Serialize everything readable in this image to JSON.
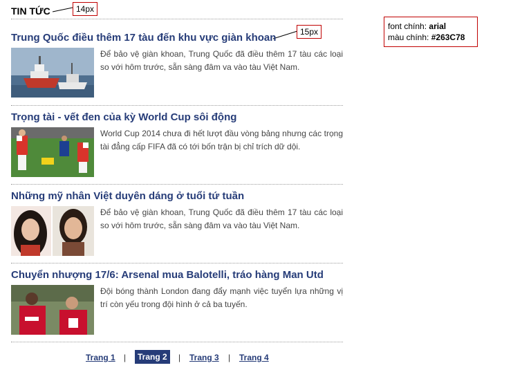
{
  "section": {
    "title": "TIN TỨC"
  },
  "annotations": {
    "title_size": "14px",
    "headline_size": "15px"
  },
  "info_box": {
    "font_label": "font chính:",
    "font_value": "arial",
    "color_label": "màu chính:",
    "color_value": "#263C78"
  },
  "colors": {
    "primary": "#263C78",
    "annotation_border": "#c00000",
    "divider": "#9a9a9a"
  },
  "articles": [
    {
      "title": "Trung Quốc điều thêm 17 tàu đến khu vực giàn khoan",
      "summary": "Để bảo vệ giàn khoan, Trung Quốc đã điều thêm 17 tàu các loại so với hôm trước, sẵn sàng đâm va vào tàu Việt Nam.",
      "image": "ships-at-sea-image"
    },
    {
      "title": "Trọng tài - vết đen của kỳ World Cup sôi động",
      "summary": "World Cup 2014 chưa đi hết lượt đầu vòng bảng nhưng các trọng tài đẳng cấp FIFA đã có tới bốn trận bị chỉ trích dữ dội.",
      "image": "football-match-image"
    },
    {
      "title": "Những mỹ nhân Việt duyên dáng ở tuổi tứ tuần",
      "summary": "Để bảo vệ giàn khoan, Trung Quốc đã điều thêm 17 tàu các loại so với hôm trước, sẵn sàng đâm va vào tàu Việt Nam.",
      "image": "two-women-portrait-image"
    },
    {
      "title": "Chuyển nhượng 17/6: Arsenal mua Balotelli, tráo hàng Man Utd",
      "summary": "Đội bóng thành London đang đẩy mạnh việc tuyển lựa những vị trí còn yếu trong đội hình ở cả ba tuyến.",
      "image": "red-jersey-players-image"
    }
  ],
  "pagination": {
    "pages": [
      "Trang 1",
      "Trang 2",
      "Trang 3",
      "Trang 4"
    ],
    "current": "Trang 2",
    "separator": "|"
  }
}
